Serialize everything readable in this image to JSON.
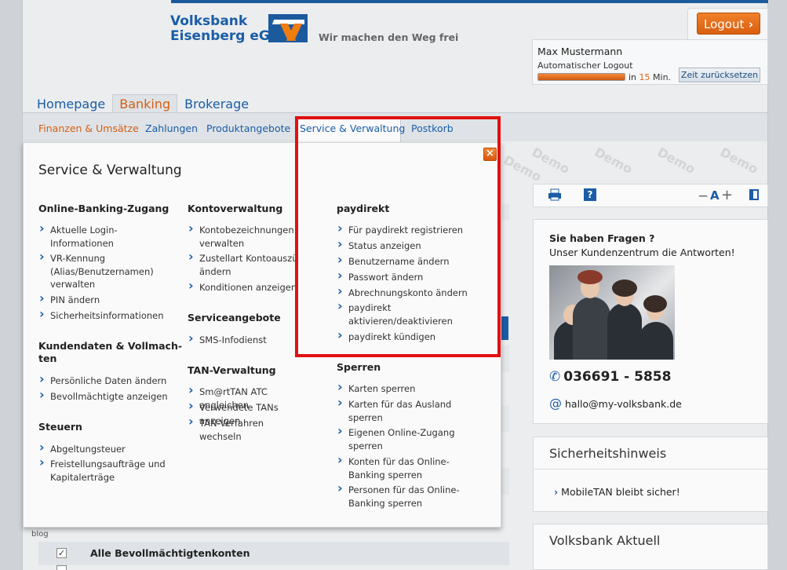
{
  "brand": {
    "line1": "Volksbank",
    "line2": "Eisenberg eG",
    "slogan": "Wir machen den Weg frei"
  },
  "session": {
    "logout_label": "Logout",
    "logout_chevron": "›",
    "user_name": "Max Mustermann",
    "auto_logout_label": "Automatischer Logout",
    "remaining_prefix": "in",
    "remaining_minutes": "15",
    "remaining_suffix": "Min.",
    "progress_percent": 100,
    "reset_label": "Zeit zurücksetzen"
  },
  "main_nav": [
    {
      "label": "Homepage",
      "active": false
    },
    {
      "label": "Banking",
      "active": true
    },
    {
      "label": "Brokerage",
      "active": false
    }
  ],
  "sub_nav": [
    {
      "label": "Finanzen & Umsätze",
      "highlight": true
    },
    {
      "label": "Zahlungen",
      "highlight": false
    },
    {
      "label": "Produktangebote",
      "highlight": false
    },
    {
      "label": "Service & Verwaltung",
      "highlight": false,
      "active": true
    },
    {
      "label": "Postkorb",
      "highlight": false
    }
  ],
  "watermark": "Demo",
  "panel": {
    "title": "Service & Verwaltung",
    "close_symbol": "×",
    "col1": {
      "sec1_title": "Online-Banking-Zugang",
      "sec1_items": [
        "Aktuelle Login-\nInformationen",
        "VR-Kennung\n(Alias/Benutzernamen)\nverwalten",
        "PIN ändern",
        "Sicherheitsinformationen"
      ],
      "sec2_title": "Kundendaten & Vollmach-\nten",
      "sec2_items": [
        "Persönliche Daten ändern",
        "Bevollmächtigte anzeigen"
      ],
      "sec3_title": "Steuern",
      "sec3_items": [
        "Abgeltungsteuer",
        "Freistellungsaufträge und\nKapitalerträge"
      ]
    },
    "col2": {
      "sec1_title": "Kontoverwaltung",
      "sec1_items": [
        "Kontobezeichnungen\nverwalten",
        "Zustellart Kontoauszüg\nändern",
        "Konditionen anzeigen"
      ],
      "sec2_title": "Serviceangebote",
      "sec2_items": [
        "SMS-Infodienst"
      ],
      "sec3_title": "TAN-Verwaltung",
      "sec3_items": [
        "Sm@rtTAN ATC angleichen",
        "Verwendete TANs anzeigen",
        "TAN-Verfahren wechseln"
      ]
    },
    "col3": {
      "sec1_title": "paydirekt",
      "sec1_items": [
        "Für paydirekt registrieren",
        "Status anzeigen",
        "Benutzername ändern",
        "Passwort ändern",
        "Abrechnungskonto ändern",
        "paydirekt\naktivieren/deaktivieren",
        "paydirekt kündigen"
      ],
      "sec2_title": "Sperren",
      "sec2_items": [
        "Karten sperren",
        "Karten für das Ausland\nsperren",
        "Eigenen Online-Zugang\nsperren",
        "Konten für das Online-\nBanking sperren",
        "Personen für das Online-\nBanking sperren"
      ]
    }
  },
  "toolbar": {
    "print_icon": "print-icon",
    "help_symbol": "?",
    "font_minus": "−",
    "font_a": "A",
    "font_plus": "+"
  },
  "contact": {
    "title": "Sie haben Fragen ?",
    "subtitle": "Unser Kundenzentrum die Antworten!",
    "phone": "036691 - 5858",
    "email": "hallo@my-volksbank.de"
  },
  "security": {
    "title": "Sicherheitshinweis",
    "link": "MobileTAN bleibt sicher!"
  },
  "news": {
    "title": "Volksbank Aktuell"
  },
  "background": {
    "blog": "blog",
    "accounts_label": "Alle Bevollmächtigtenkonten",
    "checkmark": "✓"
  },
  "colors": {
    "brand_blue": "#1a5da6",
    "brand_orange": "#ef7d0f",
    "highlight_red": "#e11010"
  }
}
